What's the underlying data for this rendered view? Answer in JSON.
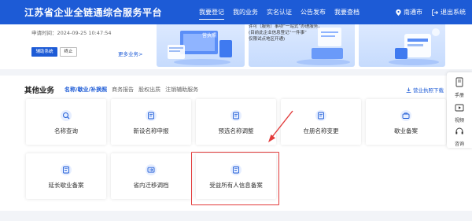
{
  "header": {
    "title": "江苏省企业全链通综合服务平台",
    "nav": [
      "我要登记",
      "我的业务",
      "实名认证",
      "公告发布",
      "我要查档"
    ],
    "active_nav": "我要登记",
    "location": "南通市",
    "logout": "退出系统",
    "bg_color": "#1d5bd6"
  },
  "upper": {
    "apply_time": "申请时间：2024-09-25 10:47:54",
    "aux_button": "辅助系统",
    "stop_button": "终止",
    "more_business": "更多业务>",
    "banner1_text": "营执照",
    "banner2_lines": [
      "许可（服务）事项“一站式”办理服务，",
      "(目前此企业信息登记“一件事”",
      "仅限试点地区开通)"
    ]
  },
  "section": {
    "title": "其他业务",
    "tabs": [
      "名称/歇业/补换照",
      "商务报告",
      "股权出质",
      "注销辅助服务"
    ],
    "active_tab": "名称/歇业/补换照",
    "download": "营业执照下载"
  },
  "cards": [
    {
      "label": "名称查询",
      "icon": "search-record-icon"
    },
    {
      "label": "新设名称申报",
      "icon": "form-icon"
    },
    {
      "label": "预选名称调整",
      "icon": "form-icon"
    },
    {
      "label": "在册名称变更",
      "icon": "form-icon"
    },
    {
      "label": "歇业备案",
      "icon": "briefcase-icon"
    },
    {
      "label": "延长歇业备案",
      "icon": "form-icon"
    },
    {
      "label": "省内迁移调档",
      "icon": "transfer-icon"
    },
    {
      "label": "受益所有人信息备案",
      "icon": "form-icon"
    }
  ],
  "side": {
    "items": [
      "手册",
      "视频",
      "咨询"
    ]
  }
}
